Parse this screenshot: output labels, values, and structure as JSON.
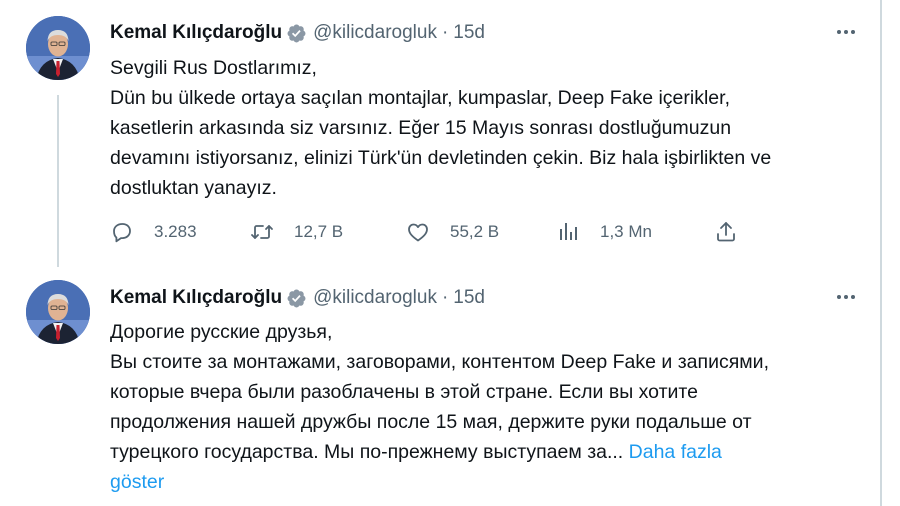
{
  "tweet1": {
    "author": {
      "name": "Kemal Kılıçdaroğlu",
      "handle": "@kilicdarogluk",
      "separator": "·",
      "time": "15d"
    },
    "text_lines": [
      "Sevgili Rus Dostlarımız,",
      "Dün bu ülkede ortaya saçılan montajlar, kumpaslar, Deep Fake içerikler,",
      "kasetlerin arkasında siz varsınız. Eğer 15 Mayıs sonrası dostluğumuzun",
      "devamını istiyorsanız, elinizi Türk'ün devletinden çekin. Biz hala işbirlikten ve",
      "dostluktan yanayız."
    ],
    "actions": {
      "replies": "3.283",
      "retweets": "12,7 B",
      "likes": "55,2 B",
      "views": "1,3 Mn"
    }
  },
  "tweet2": {
    "author": {
      "name": "Kemal Kılıçdaroğlu",
      "handle": "@kilicdarogluk",
      "separator": "·",
      "time": "15d"
    },
    "text_lines": [
      "Дорогие русские друзья,",
      "Вы стоите за монтажами, заговорами, контентом Deep Fake и записями,",
      "которые вчера были разоблачены в этой стране. Если вы хотите",
      "продолжения нашей дружбы после 15 мая, держите руки подальше от",
      "турецкого государства. Мы по-прежнему выступаем за..."
    ],
    "show_more_part1": "Daha fazla",
    "show_more_part2": "göster"
  },
  "icons": [
    "verified-badge-icon",
    "more-options-icon",
    "reply-icon",
    "retweet-icon",
    "like-icon",
    "views-icon",
    "share-icon"
  ],
  "colors": {
    "accent": "#1d9bf0",
    "text": "#0f1419",
    "secondary": "#536471",
    "divider": "#cfd9de"
  }
}
